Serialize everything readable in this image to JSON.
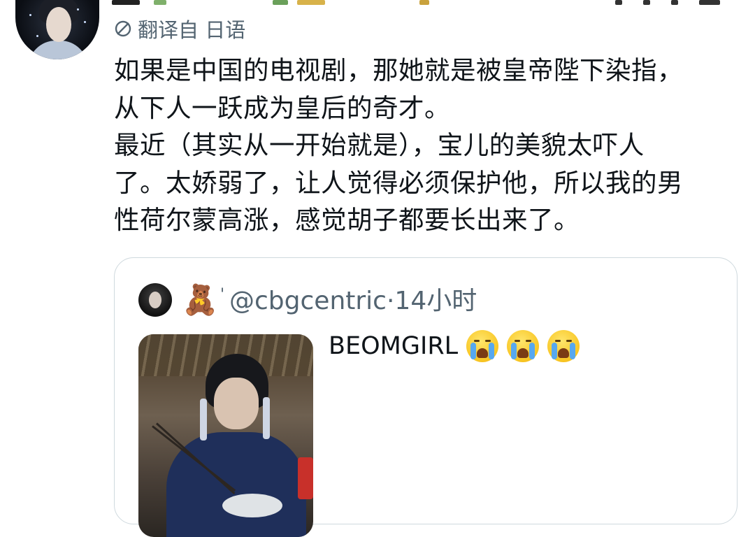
{
  "tweet": {
    "translated_label": "翻译自 日语",
    "text_lines": [
      "如果是中国的电视剧，那她就是被皇帝陛下染指，",
      "从下人一跃成为皇后的奇才。",
      "最近（其实从一开始就是），宝儿的美貌太吓人",
      "了。太娇弱了，让人觉得必须保护他，所以我的男",
      "性荷尔蒙高涨，感觉胡子都要长出来了。"
    ]
  },
  "quote": {
    "emoji_icon": "bear-face",
    "mark": "'",
    "handle": "@cbgcentric",
    "separator": "·",
    "time": "14小时",
    "text": "BEOMGIRL",
    "trailing_emoji": [
      "loudly-crying-face",
      "loudly-crying-face",
      "loudly-crying-face"
    ]
  },
  "colors": {
    "text_primary": "#0f1419",
    "text_secondary": "#536471",
    "border": "#cfd9de"
  }
}
